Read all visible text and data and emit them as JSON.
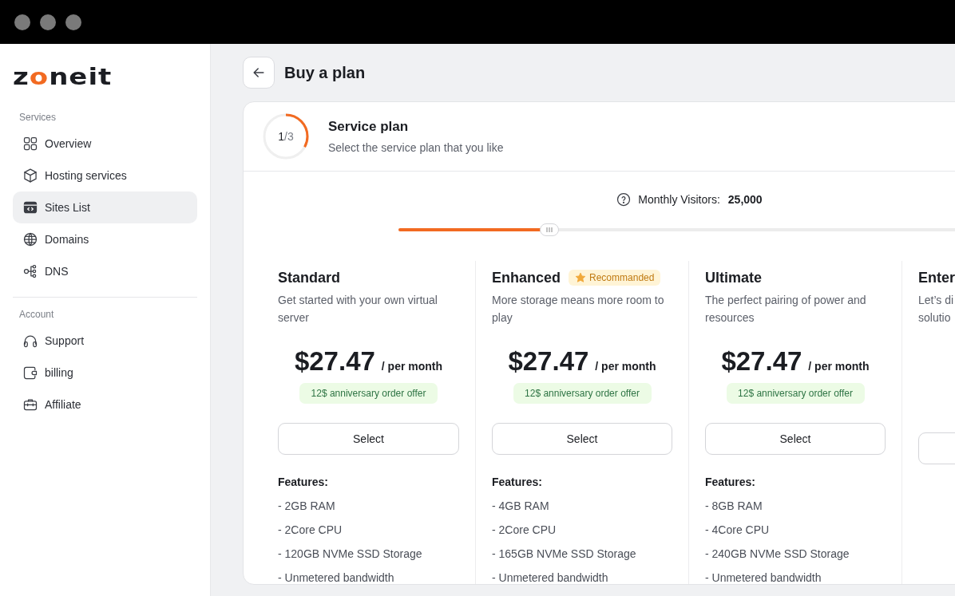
{
  "logo": {
    "before": "z",
    "accent": "o",
    "after": "neit"
  },
  "sidebar": {
    "sections": [
      {
        "title": "Services",
        "items": [
          {
            "label": "Overview",
            "selected": false
          },
          {
            "label": "Hosting services",
            "selected": false
          },
          {
            "label": "Sites List",
            "selected": true
          },
          {
            "label": "Domains",
            "selected": false
          },
          {
            "label": "DNS",
            "selected": false
          }
        ]
      },
      {
        "title": "Account",
        "items": [
          {
            "label": "Support",
            "selected": false
          },
          {
            "label": "billing",
            "selected": false
          },
          {
            "label": "Affiliate",
            "selected": false
          }
        ]
      }
    ]
  },
  "page_title": "Buy a plan",
  "step": {
    "current": "1",
    "rest": "/3",
    "level": 0.33,
    "title": "Service plan",
    "subtitle": "Select the service plan that you like"
  },
  "visitors": {
    "label": "Monthly Visitors:",
    "value": "25,000",
    "level": 0.26
  },
  "plans": [
    {
      "kind": "full",
      "name": "Standard",
      "description": "Get started with your own virtual server",
      "price": "$27.47",
      "period": "/ per month",
      "offer": "12$ anniversary order offer",
      "button": "Select",
      "features_title": "Features:",
      "features": [
        "- 2GB RAM",
        "- 2Core CPU",
        "- 120GB NVMe SSD Storage",
        "- Unmetered bandwidth"
      ]
    },
    {
      "kind": "full",
      "name": "Enhanced",
      "badge": "Recommanded",
      "description": "More storage means more room to play",
      "price": "$27.47",
      "period": "/ per month",
      "offer": "12$ anniversary order offer",
      "button": "Select",
      "features_title": "Features:",
      "features": [
        "- 4GB RAM",
        "- 2Core CPU",
        "- 165GB NVMe SSD Storage",
        "- Unmetered bandwidth"
      ]
    },
    {
      "kind": "full",
      "name": "Ultimate",
      "description": "The perfect pairing of power and resources",
      "price": "$27.47",
      "period": "/ per month",
      "offer": "12$ anniversary order offer",
      "button": "Select",
      "features_title": "Features:",
      "features": [
        "- 8GB RAM",
        "- 4Core CPU",
        "- 240GB NVMe SSD Storage",
        "- Unmetered bandwidth"
      ]
    },
    {
      "kind": "partial",
      "name": "Enter",
      "description": "Let’s di solutio"
    }
  ]
}
